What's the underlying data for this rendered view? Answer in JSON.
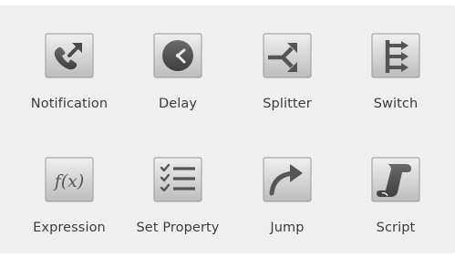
{
  "palette": {
    "panel_bg": "#efefef",
    "icon_face_light": "#e6e6e6",
    "icon_face_dark": "#bdbdbd",
    "icon_glyph": "#5a5a5a",
    "label_text": "#3c3c3c"
  },
  "nodes": [
    {
      "label": "Notification",
      "icon": "phone-arrow-icon"
    },
    {
      "label": "Delay",
      "icon": "clock-icon"
    },
    {
      "label": "Splitter",
      "icon": "split-arrows-icon"
    },
    {
      "label": "Switch",
      "icon": "switch-branches-icon"
    },
    {
      "label": "Expression",
      "icon": "function-fx-icon"
    },
    {
      "label": "Set Property",
      "icon": "checklist-icon"
    },
    {
      "label": "Jump",
      "icon": "curved-arrow-icon"
    },
    {
      "label": "Script",
      "icon": "scroll-icon"
    }
  ]
}
